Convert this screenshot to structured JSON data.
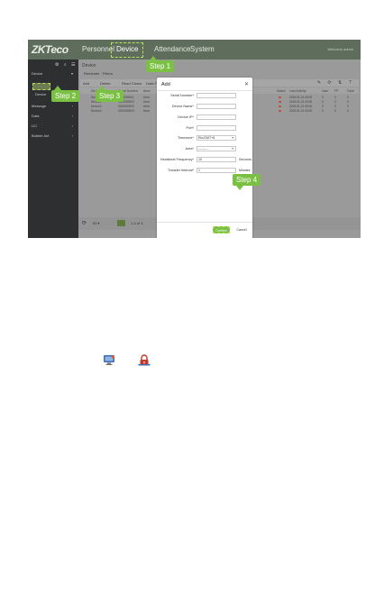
{
  "app": {
    "logo": "ZKTeco",
    "nav": [
      "Personnel",
      "Device",
      "Attendance",
      "System"
    ],
    "top_right": "Welcome admin"
  },
  "sidebar": {
    "tools": "⚙ ⌕ ☰",
    "device": "Device",
    "device_sub": "Device",
    "message": "Message",
    "data": "Data",
    "lic": "LIC",
    "bubble": "Bubble Ant"
  },
  "content": {
    "breadcrumb": "Device",
    "filters": "Reminder  ·  Filters",
    "toolbar": {
      "add": "Add",
      "delete": "Delete",
      "read_info": "Read Clears",
      "data_fix": "Data Fix"
    },
    "toolbar_icons": "✎ ⟳ ⇅ ⊤",
    "columns": [
      "",
      "Device Name",
      "Serial Number",
      "Area",
      "IP Address",
      "Status",
      "Last Activity",
      "User",
      "FP",
      "Face"
    ],
    "rows": [
      [
        "",
        "Device1",
        "0000000001",
        "Area",
        "192.168.0.101",
        "",
        "2019-01-01 00:00",
        "0",
        "0",
        "0"
      ],
      [
        "",
        "Device2",
        "0000000002",
        "Area",
        "192.168.0.102",
        "",
        "2019-01-01 00:00",
        "0",
        "0",
        "0"
      ],
      [
        "",
        "Device3",
        "0000000003",
        "Area",
        "192.168.0.103",
        "",
        "2019-01-01 00:00",
        "0",
        "0",
        "0"
      ],
      [
        "",
        "Device4",
        "0000000004",
        "Area",
        "192.168.0.104",
        "",
        "2019-01-01 00:00",
        "0",
        "0",
        "0"
      ]
    ],
    "pager": {
      "refresh": "⟳",
      "page_size": "50 ▾",
      "range": "1-4 of 4",
      "page": "1",
      "total": "of 1",
      "jump": "Jump"
    }
  },
  "dialog": {
    "title": "Add",
    "close": "✕",
    "fields": [
      {
        "label": "Serial Number*",
        "value": ""
      },
      {
        "label": "Device Name*",
        "value": ""
      },
      {
        "label": "Device IP*",
        "value": ""
      },
      {
        "label": "Port*",
        "value": ""
      },
      {
        "label": "Timezone*",
        "value": "Etc/GMT+8",
        "select": true
      },
      {
        "label": "Area*",
        "value": "---------",
        "select": true
      },
      {
        "label": "Heartbeat Frequency*",
        "value": "10",
        "suffix": "Seconds"
      },
      {
        "label": "Transfer Interval*",
        "value": "1",
        "suffix": "Minutes"
      }
    ],
    "confirm": "Confirm",
    "cancel": "Cancel"
  },
  "steps": {
    "s1": "Step 1",
    "s2": "Step 2",
    "s3": "Step 3",
    "s4": "Step 4"
  },
  "colors": {
    "accent": "#7ac143",
    "topbar": "#5f6e5c",
    "sidebar": "#2d2f31"
  },
  "icons": [
    "monitor-icon",
    "lock-icon"
  ]
}
